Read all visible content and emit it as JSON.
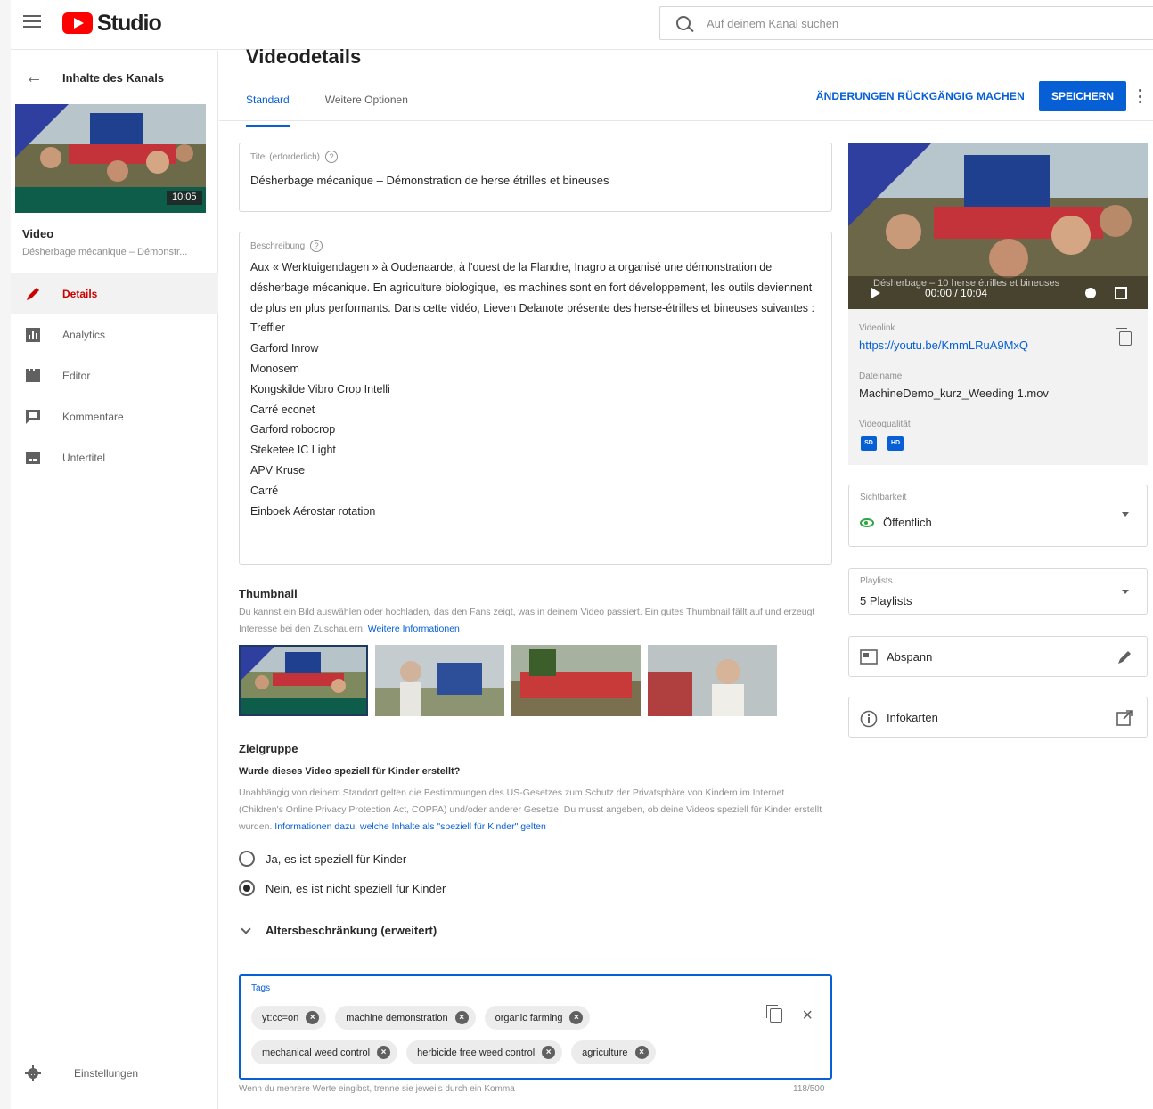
{
  "header": {
    "brand": "Studio",
    "search_placeholder": "Auf deinem Kanal suchen"
  },
  "sidebar": {
    "back_label": "Inhalte des Kanals",
    "thumb_duration": "10:05",
    "video_heading": "Video",
    "video_subtitle": "Désherbage mécanique – Démonstr...",
    "items": [
      {
        "label": "Details",
        "icon": "pencil-icon",
        "active": true
      },
      {
        "label": "Analytics",
        "icon": "analytics-icon",
        "active": false
      },
      {
        "label": "Editor",
        "icon": "editor-icon",
        "active": false
      },
      {
        "label": "Kommentare",
        "icon": "comments-icon",
        "active": false
      },
      {
        "label": "Untertitel",
        "icon": "subtitles-icon",
        "active": false
      }
    ],
    "settings_label": "Einstellungen"
  },
  "main": {
    "title": "Videodetails",
    "tabs": [
      {
        "label": "Standard",
        "active": true
      },
      {
        "label": "Weitere Optionen",
        "active": false
      }
    ],
    "undo_label": "ÄNDERUNGEN RÜCKGÄNGIG MACHEN",
    "save_label": "SPEICHERN",
    "title_field": {
      "label": "Titel (erforderlich)",
      "value": "Désherbage mécanique – Démonstration de herse étrilles et bineuses"
    },
    "description_field": {
      "label": "Beschreibung",
      "value": "Aux « Werktuigendagen » à Oudenaarde, à l'ouest de la Flandre, Inagro a organisé une démonstration de désherbage mécanique. En agriculture biologique, les machines sont en fort développement, les outils deviennent de plus en plus performants. Dans cette vidéo, Lieven Delanote présente des herse-étrilles et bineuses suivantes :\nTreffler\nGarford Inrow\nMonosem\nKongskilde Vibro Crop Intelli\nCarré econet\nGarford robocrop\nSteketee IC Light\nAPV Kruse\nCarré\nEinboek Aérostar rotation"
    },
    "thumbnail": {
      "heading": "Thumbnail",
      "text": "Du kannst ein Bild auswählen oder hochladen, das den Fans zeigt, was in deinem Video passiert. Ein gutes Thumbnail fällt auf und erzeugt Interesse bei den Zuschauern.",
      "link": "Weitere Informationen"
    },
    "audience": {
      "heading": "Zielgruppe",
      "question": "Wurde dieses Video speziell für Kinder erstellt?",
      "text": "Unabhängig von deinem Standort gelten die Bestimmungen des US-Gesetzes zum Schutz der Privatsphäre von Kindern im Internet (Children's Online Privacy Protection Act, COPPA) und/oder anderer Gesetze. Du musst angeben, ob deine Videos speziell für Kinder erstellt wurden.",
      "link": "Informationen dazu, welche Inhalte als \"speziell für Kinder\" gelten",
      "option_yes": "Ja, es ist speziell für Kinder",
      "option_no": "Nein, es ist nicht speziell für Kinder",
      "selected": "no"
    },
    "age_restriction": "Altersbeschränkung (erweitert)",
    "tags": {
      "label": "Tags",
      "row1": [
        "yt:cc=on",
        "machine demonstration",
        "organic farming"
      ],
      "row2": [
        "mechanical weed control",
        "herbicide free weed control",
        "agriculture"
      ],
      "hint": "Wenn du mehrere Werte eingibst, trenne sie jeweils durch ein Komma",
      "count": "118/500"
    }
  },
  "right_panel": {
    "player_time": "00:00 / 10:04",
    "overlay_title": "Désherbage – 10 herse étrilles et bineuses",
    "videolink_label": "Videolink",
    "videolink_value": "https://youtu.be/KmmLRuA9MxQ",
    "filename_label": "Dateiname",
    "filename_value": "MachineDemo_kurz_Weeding 1.mov",
    "quality_label": "Videoqualität",
    "quality_badges": [
      "SD",
      "HD"
    ],
    "visibility_label": "Sichtbarkeit",
    "visibility_value": "Öffentlich",
    "playlists_label": "Playlists",
    "playlists_value": "5 Playlists",
    "endscreen_label": "Abspann",
    "cards_label": "Infokarten"
  },
  "colors": {
    "accent": "#065fd4",
    "brand_red": "#ff0000",
    "active_nav": "#cc0000",
    "public_green": "#2ba640"
  }
}
